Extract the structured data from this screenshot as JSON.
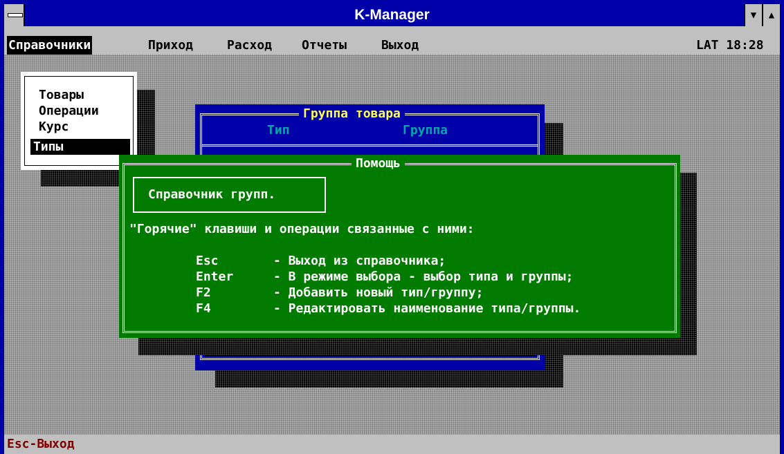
{
  "window": {
    "title": "K-Manager",
    "minimize_glyph": "▼",
    "maximize_glyph": "▲"
  },
  "menubar": {
    "items": [
      {
        "label": "Справочники"
      },
      {
        "label": "Приход"
      },
      {
        "label": "Расход"
      },
      {
        "label": "Отчеты"
      },
      {
        "label": "Выход"
      }
    ],
    "status_right": "LAT 18:28"
  },
  "submenu": {
    "items": [
      "Товары",
      "Операции",
      "Курс",
      "Типы"
    ]
  },
  "group_window": {
    "title": "Группа товара",
    "col_type": "Тип",
    "col_group": "Группа"
  },
  "help_window": {
    "title": "Помощь",
    "heading": "Справочник групп.",
    "intro": "\"Горячие\" клавиши и операции связанные с ними:",
    "keys": [
      {
        "key": "Esc",
        "desc": "- Выход из справочника;"
      },
      {
        "key": "Enter",
        "desc": "- В режиме выбора - выбор типа и группы;"
      },
      {
        "key": "F2",
        "desc": "- Добавить новый тип/группу;"
      },
      {
        "key": "F4",
        "desc": "- Редактировать наименование типа/группы."
      }
    ]
  },
  "statusbar": {
    "text": "Esc-Выход"
  },
  "colors": {
    "window_blue": "#0000a8",
    "help_green": "#007b00",
    "caption_yellow": "#ffff55",
    "status_red": "#800000"
  },
  "icons": [
    "system-menu-icon",
    "minimize-icon",
    "maximize-icon"
  ]
}
